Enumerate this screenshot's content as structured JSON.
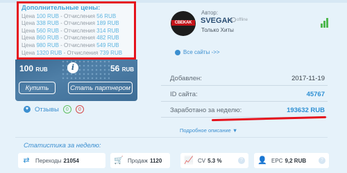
{
  "prices": {
    "title": "Дополнительные цены:",
    "price_label": "Цена",
    "commission_label": "- Отчисления",
    "rows": [
      {
        "price": "100 RUB",
        "commission": "56 RUB"
      },
      {
        "price": "338 RUB",
        "commission": "189 RUB"
      },
      {
        "price": "560 RUB",
        "commission": "314 RUB"
      },
      {
        "price": "860 RUB",
        "commission": "482 RUB"
      },
      {
        "price": "980 RUB",
        "commission": "549 RUB"
      },
      {
        "price": "1320 RUB",
        "commission": "739 RUB"
      }
    ]
  },
  "card": {
    "price_value": "100",
    "commission_value": "56",
    "currency": "RUB",
    "info_glyph": "i",
    "buy_label": "Купить",
    "partner_label": "Стать партнером"
  },
  "reviews": {
    "label": "Отзывы",
    "positive": "0",
    "negative": "0",
    "icon": "heart-icon"
  },
  "author": {
    "avatar_text": "CBEKAK",
    "label": "Автор:",
    "name": "SVEGAK",
    "status": "offline",
    "subtitle": "Только Хиты"
  },
  "all_sites_label": "Все сайты ->>",
  "details": {
    "added_label": "Добавлен:",
    "added_value": "2017-11-19",
    "site_id_label": "ID сайта:",
    "site_id_value": "45767",
    "earned_label": "Заработано за неделю:",
    "earned_value": "193632 RUB"
  },
  "more_label": "Подробное описание",
  "stats": {
    "title": "Статистика за неделю:",
    "items": [
      {
        "label": "Переходы",
        "value": "21054",
        "icon": "shuffle-icon"
      },
      {
        "label": "Продаж",
        "value": "1120",
        "icon": "cart-icon"
      },
      {
        "label": "CV",
        "value": "5.3 %",
        "icon": "chart-icon"
      },
      {
        "label": "EPC",
        "value": "9,2 RUB",
        "icon": "user-icon"
      }
    ],
    "help_glyph": "?"
  },
  "colors": {
    "accent": "#2d8fd3",
    "highlight": "#e5121c",
    "card": "#3b6a92"
  }
}
